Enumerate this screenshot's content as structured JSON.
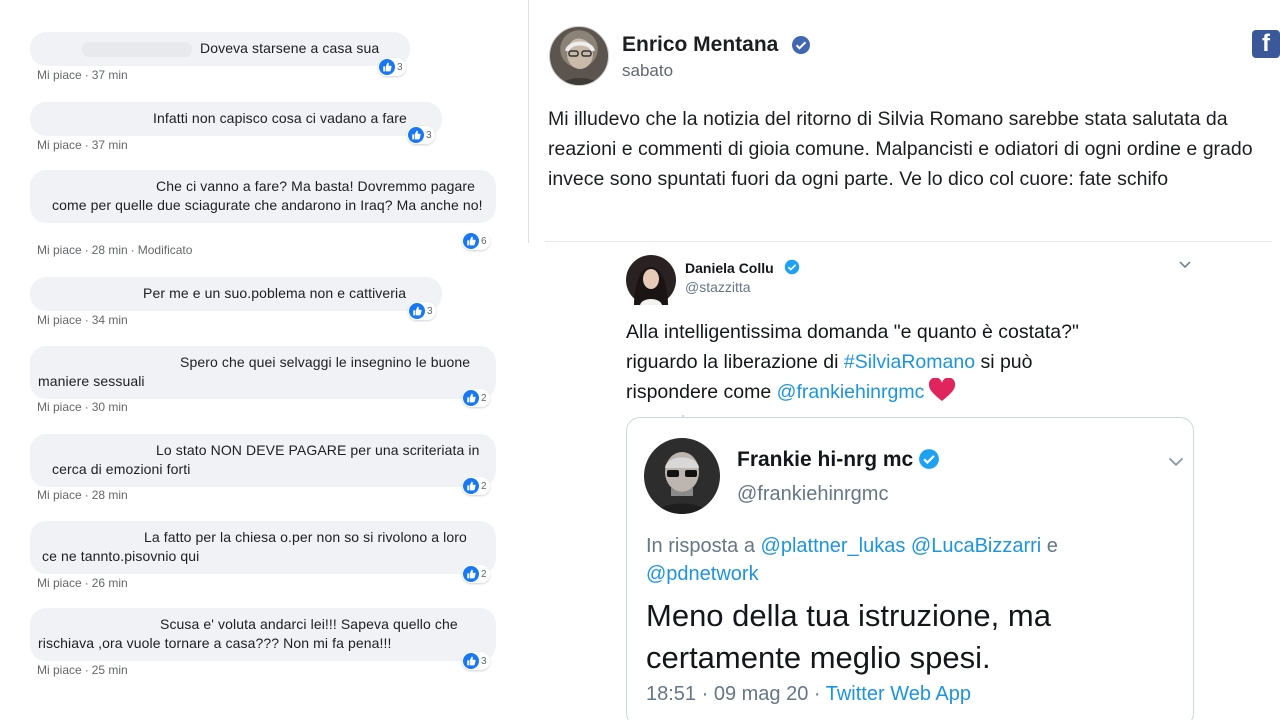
{
  "fb_comments": [
    {
      "text": "Doveva starsene a casa sua",
      "like_label": "Mi piace",
      "time": "37 min",
      "reactions": "3",
      "edited": ""
    },
    {
      "text": "Infatti non capisco cosa ci vadano a fare",
      "like_label": "Mi piace",
      "time": "37 min",
      "reactions": "3",
      "edited": ""
    },
    {
      "text": "Che ci vanno a fare? Ma basta! Dovremmo pagare come per quelle due sciagurate che andarono in Iraq? Ma anche no!",
      "like_label": "Mi piace",
      "time": "28 min",
      "reactions": "6",
      "edited": "Modificato"
    },
    {
      "text": "Per me e un suo.poblema non e cattiveria",
      "like_label": "Mi piace",
      "time": "34 min",
      "reactions": "3",
      "edited": ""
    },
    {
      "text": "Spero che quei selvaggi le insegnino le buone maniere sessuali",
      "like_label": "Mi piace",
      "time": "30 min",
      "reactions": "2",
      "edited": ""
    },
    {
      "text": "Lo stato NON DEVE PAGARE per una scriteriata in cerca di emozioni forti",
      "like_label": "Mi piace",
      "time": "28 min",
      "reactions": "2",
      "edited": ""
    },
    {
      "text": "La fatto per la chiesa o.per non so si rivolono a loro ce ne tannto.pisovnio qui",
      "like_label": "Mi piace",
      "time": "26 min",
      "reactions": "2",
      "edited": ""
    },
    {
      "text": "Scusa e' voluta andarci lei!!! Sapeva quello che rischiava ,ora vuole tornare a casa??? Non mi fa pena!!!",
      "like_label": "Mi piace",
      "time": "25 min",
      "reactions": "3",
      "edited": ""
    }
  ],
  "fb_post": {
    "author": "Enrico Mentana",
    "date": "sabato",
    "text": "Mi illudevo che la notizia del ritorno di Silvia Romano sarebbe stata salutata da reazioni e commenti di gioia comune. Malpancisti e odiatori di ogni ordine e grado invece sono spuntati fuori da ogni parte. Ve lo dico col cuore: fate schifo",
    "logo_letter": "f",
    "brand_color": "#3b5998"
  },
  "tweet": {
    "author": "Daniela Collu",
    "handle": "@stazzitta",
    "text_1": "Alla intelligentissima domanda \"e quanto è costata?\" riguardo la liberazione di ",
    "hashtag": "#SilviaRomano",
    "text_2": " si può rispondere come ",
    "mention": "@frankiehinrgmc",
    "link_color": "#1b95e0",
    "quoted": {
      "author": "Frankie hi-nrg mc",
      "handle": "@frankiehinrgmc",
      "reply_prefix": "In risposta a ",
      "reply_to": "@plattner_lukas @LucaBizzarri",
      "reply_and": " e ",
      "reply_last": "@pdnetwork",
      "text": "Meno della tua istruzione, ma certamente meglio spesi.",
      "time": "18:51 · 09 mag 20 · ",
      "app": "Twitter Web App"
    }
  }
}
